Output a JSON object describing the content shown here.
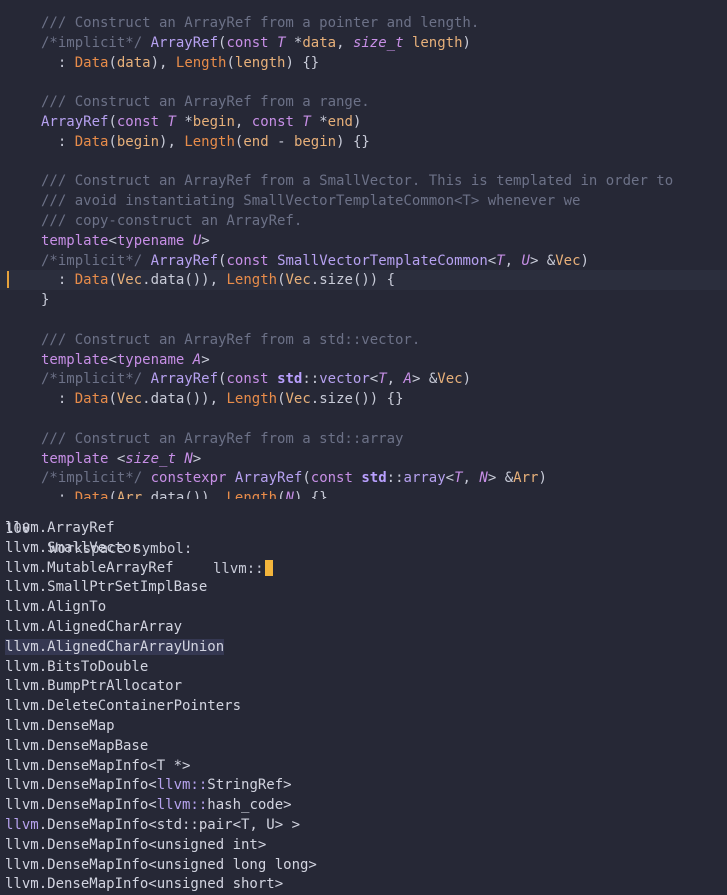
{
  "editor": {
    "lines": [
      {
        "text": "/// Construct an ArrayRef from a pointer and length.",
        "kind": "comment"
      },
      {
        "text": "/*implicit*/ ArrayRef(const T *data, size_t length)",
        "kind": "code"
      },
      {
        "text": "  : Data(data), Length(length) {}",
        "kind": "code"
      },
      {
        "text": "",
        "kind": "blank"
      },
      {
        "text": "/// Construct an ArrayRef from a range.",
        "kind": "comment"
      },
      {
        "text": "ArrayRef(const T *begin, const T *end)",
        "kind": "code"
      },
      {
        "text": "  : Data(begin), Length(end - begin) {}",
        "kind": "code"
      },
      {
        "text": "",
        "kind": "blank"
      },
      {
        "text": "/// Construct an ArrayRef from a SmallVector. This is templated in order to",
        "kind": "comment"
      },
      {
        "text": "/// avoid instantiating SmallVectorTemplateCommon<T> whenever we",
        "kind": "comment"
      },
      {
        "text": "/// copy-construct an ArrayRef.",
        "kind": "comment"
      },
      {
        "text": "template<typename U>",
        "kind": "code"
      },
      {
        "text": "/*implicit*/ ArrayRef(const SmallVectorTemplateCommon<T, U> &Vec)",
        "kind": "code"
      },
      {
        "text": "  : Data(Vec.data()), Length(Vec.size()) {",
        "kind": "code"
      },
      {
        "text": "}",
        "kind": "code"
      },
      {
        "text": "",
        "kind": "blank"
      },
      {
        "text": "/// Construct an ArrayRef from a std::vector.",
        "kind": "comment"
      },
      {
        "text": "template<typename A>",
        "kind": "code"
      },
      {
        "text": "/*implicit*/ ArrayRef(const std::vector<T, A> &Vec)",
        "kind": "code"
      },
      {
        "text": "  : Data(Vec.data()), Length(Vec.size()) {}",
        "kind": "code"
      },
      {
        "text": "",
        "kind": "blank"
      },
      {
        "text": "/// Construct an ArrayRef from a std::array",
        "kind": "comment"
      },
      {
        "text": "template <size_t N>",
        "kind": "code"
      },
      {
        "text": "/*implicit*/ constexpr ArrayRef(const std::array<T, N> &Arr)",
        "kind": "code"
      },
      {
        "text": "  : Data(Arr.data()), Length(N) {}",
        "kind": "code"
      }
    ],
    "current_line": 13
  },
  "picker": {
    "count": "100",
    "label": "Workspace symbol:",
    "query": "llvm::",
    "selected_index": 6,
    "items": [
      "llvm.ArrayRef",
      "llvm.SmallVector",
      "llvm.MutableArrayRef",
      "llvm.SmallPtrSetImplBase",
      "llvm.AlignTo",
      "llvm.AlignedCharArray",
      "llvm.AlignedCharArrayUnion",
      "llvm.BitsToDouble",
      "llvm.BumpPtrAllocator",
      "llvm.DeleteContainerPointers",
      "llvm.DenseMap",
      "llvm.DenseMapBase",
      "llvm.DenseMapInfo<T *>",
      "llvm.DenseMapInfo<llvm::StringRef>",
      "llvm.DenseMapInfo<llvm::hash_code>",
      "llvm.DenseMapInfo<std::pair<T, U> >",
      "llvm.DenseMapInfo<unsigned int>",
      "llvm.DenseMapInfo<unsigned long long>",
      "llvm.DenseMapInfo<unsigned short>"
    ]
  },
  "colors": {
    "background": "#262836",
    "cursor": "#f3b53c",
    "selection": "#353852",
    "comment": "#6c7187",
    "keyword": "#c78fe6"
  }
}
